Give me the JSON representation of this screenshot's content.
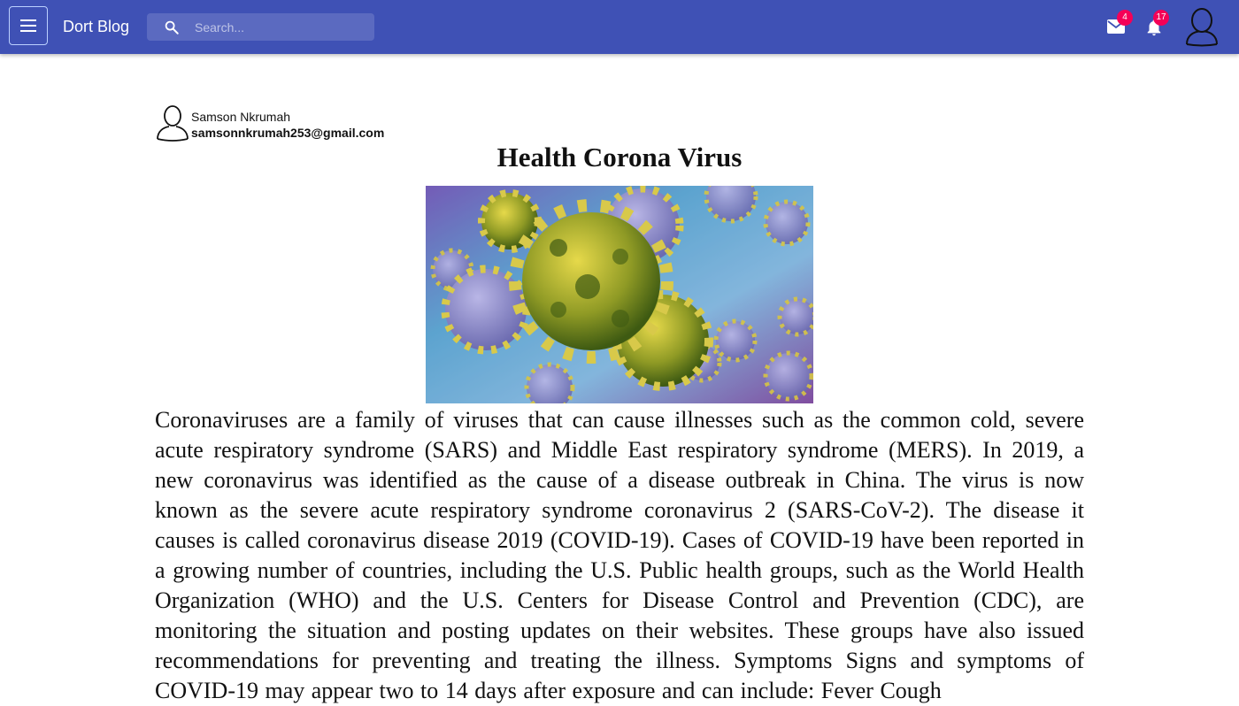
{
  "app": {
    "brand": "Dort Blog"
  },
  "appbar": {
    "menu_icon": "menu-icon",
    "search": {
      "placeholder": "Search...",
      "value": "",
      "icon": "search-icon"
    },
    "mail": {
      "icon": "mail-icon",
      "badge": "4"
    },
    "notifications": {
      "icon": "bell-icon",
      "badge": "17"
    },
    "account": {
      "icon": "account-icon"
    }
  },
  "post": {
    "author": {
      "name": "Samson Nkrumah",
      "email": "samsonnkrumah253@gmail.com",
      "icon": "user-icon"
    },
    "title": "Health Corona Virus",
    "body": "Coronaviruses are a family of viruses that can cause illnesses such as the common cold, severe acute respiratory syndrome (SARS) and Middle East respiratory syndrome (MERS). In 2019, a new coronavirus was identified as the cause of a disease outbreak in China. The virus is now known as the severe acute respiratory syndrome coronavirus 2 (SARS-CoV-2). The disease it causes is called coronavirus disease 2019 (COVID-19). Cases of COVID-19 have been reported in a growing number of countries, including the U.S. Public health groups, such as the World Health Organization (WHO) and the U.S. Centers for Disease Control and Prevention (CDC), are monitoring the situation and posting updates on their websites. These groups have also issued recommendations for preventing and treating the illness. Symptoms Signs and symptoms of COVID-19 may appear two to 14 days after exposure and can include: Fever Cough"
  },
  "colors": {
    "appbar": "#3f51b5",
    "badge": "#f50057",
    "text": "#111111"
  }
}
